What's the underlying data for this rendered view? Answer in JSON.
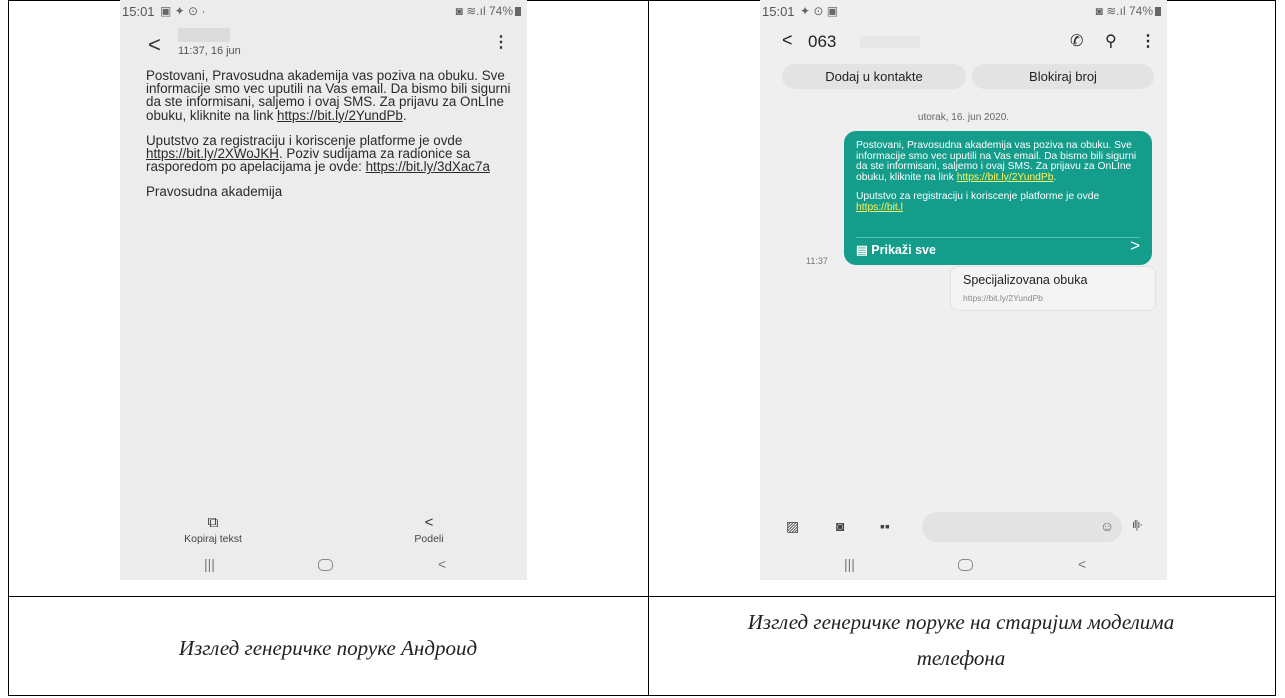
{
  "phone_android": {
    "status": {
      "time": "15:01",
      "icons_left": "▣ ✦ ⊙ ·",
      "battery": "74%"
    },
    "header": {
      "time": "11:37, 16 jun"
    },
    "message": {
      "p1_a": "Postovani, Pravosudna akademija vas poziva na obuku. Sve informacije smo vec uputili na Vas email. Da bismo bili sigurni da ste informisani, saljemo i ovaj SMS. Za prijavu za OnLIne obuku, kliknite na link ",
      "p1_link": "https://bit.ly/2YundPb",
      "p1_end": ".",
      "p2_a": "Uputstvo za registraciju i koriscenje platforme je ovde ",
      "p2_link1": "https://bit.ly/2XWoJKH",
      "p2_b": ". Poziv sudijama za radionice sa rasporedom po apelacijama je ovde: ",
      "p2_link2": "https://bit.ly/3dXac7a",
      "p3": "Pravosudna akademija"
    },
    "actions": {
      "copy": "Kopiraj tekst",
      "share": "Podeli"
    }
  },
  "phone_older": {
    "status": {
      "time": "15:01",
      "battery": "74%"
    },
    "header": {
      "number": "063"
    },
    "buttons": {
      "add_contact": "Dodaj u kontakte",
      "block": "Blokiraj broj"
    },
    "date": "utorak, 16. jun 2020.",
    "bubble": {
      "p1_a": "Postovani, Pravosudna akademija vas poziva na obuku. Sve informacije smo vec uputili na Vas email. Da bismo bili sigurni da ste informisani, saljemo i ovaj SMS. Za prijavu za OnLIne obuku, kliknite na link ",
      "p1_link": "https://bit.ly/2YundPb",
      "p1_end": ".",
      "p2_a": "Uputstvo za registraciju i koriscenje platforme je ovde ",
      "p2_link": "https://bit.l",
      "show_all": "Prikaži sve"
    },
    "time": "11:37",
    "preview": {
      "title": "Specijalizovana obuka",
      "url": "https://bit.ly/2YundPb"
    }
  },
  "captions": {
    "left": "Изглед генеричке поруке Андроид",
    "right_line1": "Изглед генеричке поруке на старијим моделима",
    "right_line2": "телефона"
  }
}
